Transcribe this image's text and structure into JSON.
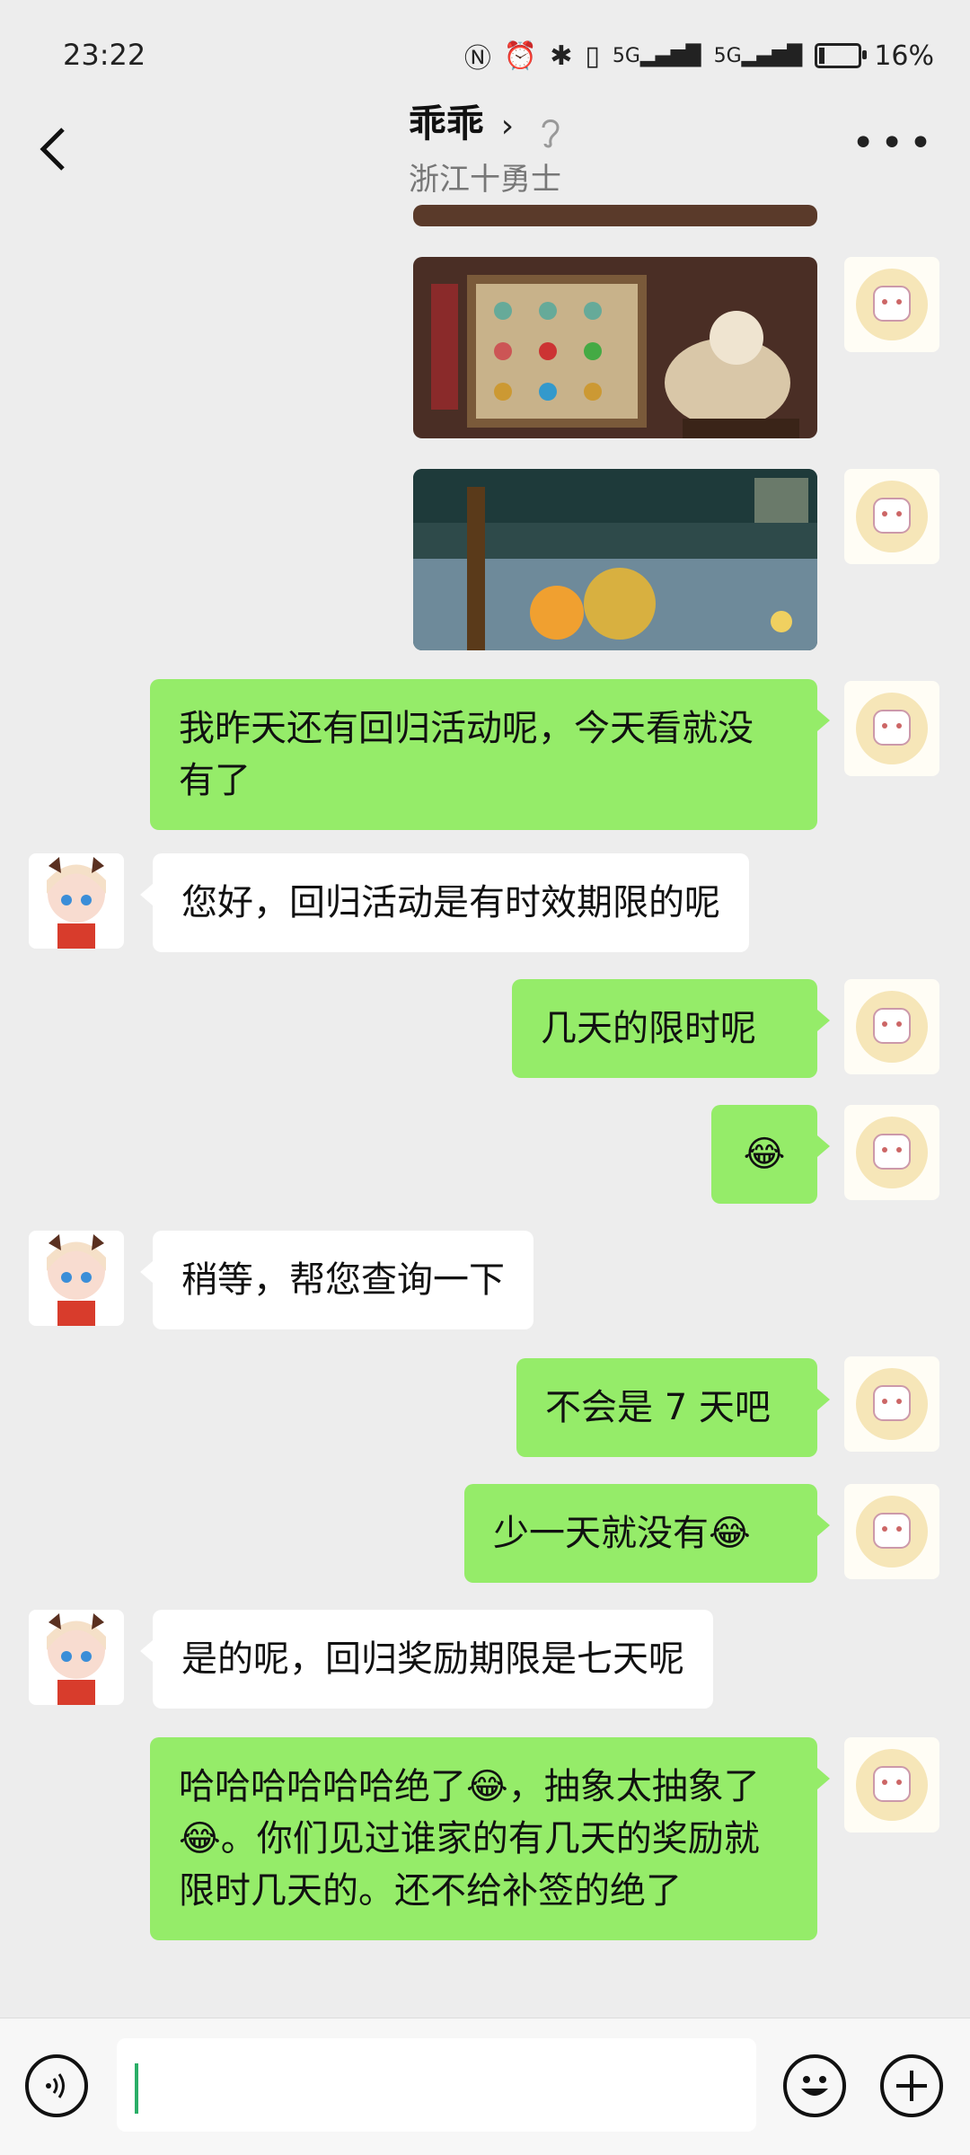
{
  "status_bar": {
    "time": "23:22",
    "battery": "16%",
    "battery_level": 0.16,
    "network": "5G"
  },
  "header": {
    "title": "乖乖",
    "subtitle": "浙江十勇士"
  },
  "messages": [
    {
      "sender": "me",
      "type": "image",
      "description": "game shop screenshot"
    },
    {
      "sender": "me",
      "type": "image",
      "description": "game battle screenshot"
    },
    {
      "sender": "me",
      "text": "我昨天还有回归活动呢，今天看就没有了"
    },
    {
      "sender": "them",
      "text": "您好，回归活动是有时效期限的呢"
    },
    {
      "sender": "me",
      "text": "几天的限时呢"
    },
    {
      "sender": "me",
      "text": "😂"
    },
    {
      "sender": "them",
      "text": "稍等，帮您查询一下"
    },
    {
      "sender": "me",
      "text": "不会是 7 天吧"
    },
    {
      "sender": "me",
      "text": "少一天就没有😂"
    },
    {
      "sender": "them",
      "text": "是的呢，回归奖励期限是七天呢"
    },
    {
      "sender": "me",
      "text": "哈哈哈哈哈哈绝了😂，抽象太抽象了😂。你们见过谁家的有几天的奖励就限时几天的。还不给补签的绝了"
    }
  ],
  "colors": {
    "my_bubble": "#95ec69",
    "their_bubble": "#ffffff",
    "background": "#ededed",
    "caret": "#2aae67"
  },
  "icons": [
    "back-icon",
    "chevron-right-icon",
    "ear-icon",
    "more-icon",
    "voice-icon",
    "emoji-icon",
    "plus-icon"
  ]
}
